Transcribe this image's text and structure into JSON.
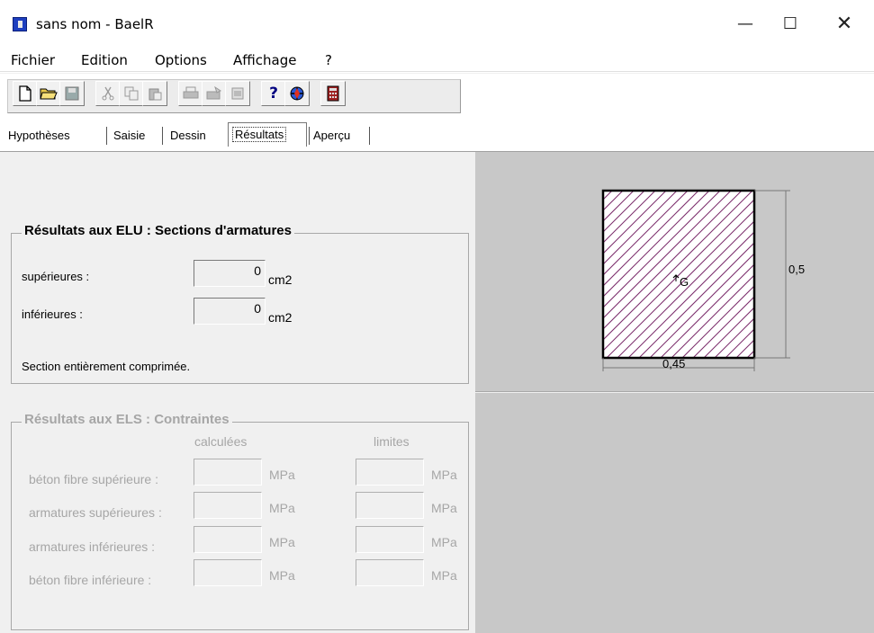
{
  "window": {
    "title": "sans nom - BaelR"
  },
  "menu": {
    "items": [
      "Fichier",
      "Edition",
      "Options",
      "Affichage",
      "?"
    ]
  },
  "toolbar": {
    "buttons": [
      "new-file-icon",
      "open-folder-icon",
      "save-icon",
      "cut-icon",
      "copy-icon",
      "paste-icon",
      "print-icon",
      "print-setup-icon",
      "print-preview-icon",
      "help-icon",
      "about-icon",
      "calculator-icon"
    ],
    "help_glyph": "?"
  },
  "tabs": {
    "items": [
      "Hypothèses",
      "Saisie",
      "Dessin",
      "Résultats",
      "Aperçu"
    ],
    "active": "Résultats"
  },
  "elu": {
    "title": "Résultats aux ELU : Sections d'armatures",
    "sup_label": "supérieures :",
    "sup_value": "0",
    "inf_label": "inférieures :",
    "inf_value": "0",
    "unit": "cm2",
    "status": "Section entièrement comprimée."
  },
  "els": {
    "title": "Résultats aux ELS : Contraintes",
    "col_calc": "calculées",
    "col_lim": "limites",
    "unit": "MPa",
    "rows": [
      {
        "label": "béton fibre supérieure :"
      },
      {
        "label": "armatures supérieures :"
      },
      {
        "label": "armatures inférieures :"
      },
      {
        "label": "béton fibre inférieure :"
      }
    ]
  },
  "drawing": {
    "width_label": "0,45",
    "height_label": "0,5",
    "centroid_label": "G",
    "hatch_color": "#7a2a6a",
    "background": "#c8c8c8"
  }
}
